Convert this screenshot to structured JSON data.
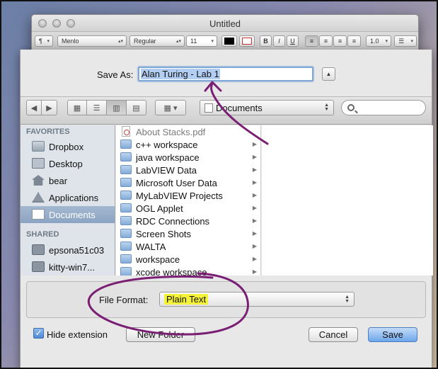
{
  "window": {
    "title": "Untitled",
    "format_bar": {
      "paragraph_glyph": "¶",
      "font_family": "Menlo",
      "font_style": "Regular",
      "font_size": "11",
      "bold": "B",
      "italic": "I",
      "underline": "U",
      "line_spacing": "1.0"
    }
  },
  "save_dialog": {
    "save_as_label": "Save As:",
    "filename_value": "Alan Turing - Lab 1",
    "location": "Documents",
    "sidebar": {
      "favorites_header": "FAVORITES",
      "favorites": [
        {
          "label": "Dropbox",
          "icon": "folder-icon"
        },
        {
          "label": "Desktop",
          "icon": "desktop-icon"
        },
        {
          "label": "bear",
          "icon": "home-icon"
        },
        {
          "label": "Applications",
          "icon": "applications-icon"
        },
        {
          "label": "Documents",
          "icon": "documents-icon",
          "selected": true
        }
      ],
      "shared_header": "SHARED",
      "shared": [
        {
          "label": "epsona51c03",
          "icon": "monitor-icon"
        },
        {
          "label": "kitty-win7...",
          "icon": "monitor-icon"
        }
      ]
    },
    "files": [
      {
        "name": "About Stacks.pdf",
        "kind": "pdf"
      },
      {
        "name": "c++ workspace",
        "kind": "folder"
      },
      {
        "name": "java workspace",
        "kind": "folder"
      },
      {
        "name": "LabVIEW Data",
        "kind": "folder"
      },
      {
        "name": "Microsoft User Data",
        "kind": "folder"
      },
      {
        "name": "MyLabVIEW Projects",
        "kind": "folder"
      },
      {
        "name": "OGL Applet",
        "kind": "folder"
      },
      {
        "name": "RDC Connections",
        "kind": "folder"
      },
      {
        "name": "Screen Shots",
        "kind": "folder"
      },
      {
        "name": "WALTA",
        "kind": "folder"
      },
      {
        "name": "workspace",
        "kind": "folder"
      },
      {
        "name": "xcode workspace",
        "kind": "folder"
      }
    ],
    "file_format_label": "File Format:",
    "file_format_value": "Plain Text",
    "hide_extension_label": "Hide extension",
    "new_folder_label": "New Folder",
    "cancel_label": "Cancel",
    "save_label": "Save"
  },
  "colors": {
    "highlight_marker": "#f5f23a",
    "annotation_ink": "#7a1f73",
    "selection_blue": "#b2cff3"
  }
}
